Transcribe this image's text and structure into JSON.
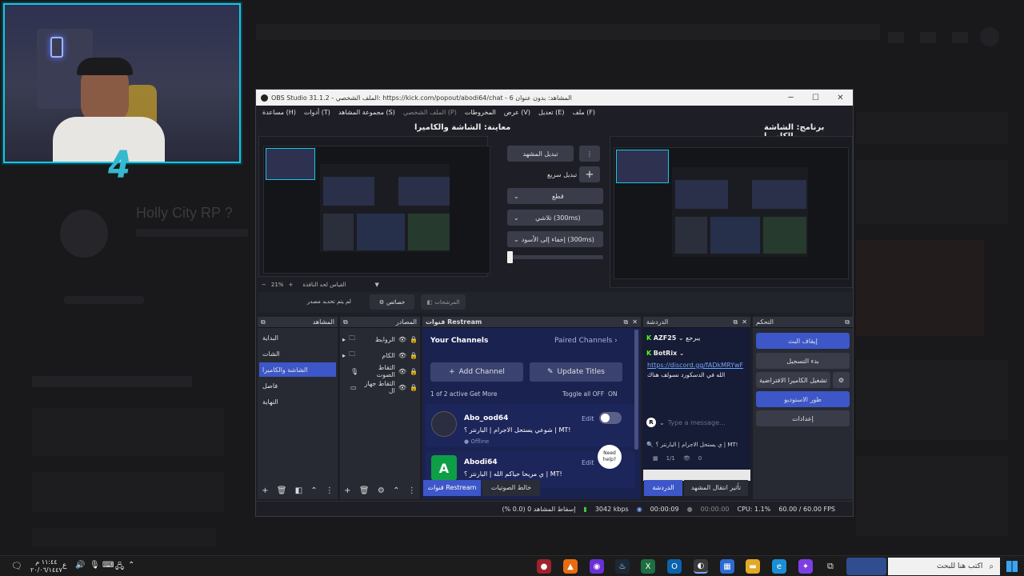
{
  "obs": {
    "title": "OBS Studio 31.1.2 - الملف الشخصي: https://kick.com/popout/abodi64/chat - المشاهد: بدون عنوان 6",
    "menu": [
      "ملف (F)",
      "تعديل (E)",
      "عرض (V)",
      "المخروطات",
      "الملف الشخصي (P)",
      "مجموعة المشاهد (S)",
      "أدوات (T)",
      "مساعدة (H)"
    ],
    "program_label": "برنامج: الشاشة والكاميرا",
    "preview_label": "معاينة: الشاشة والكاميرا",
    "transition": {
      "change_scene": "تبديل المشهد",
      "quick_transition": "تبديل سريع",
      "cut": "قطع",
      "fade": "تلاشي (300ms)",
      "fade_black": "إخفاء إلى الأسود (300ms)"
    },
    "zoom": "21%",
    "fit_label": "القياس لحد النافذة",
    "no_source": "لم يتم تحديد مصدر",
    "properties_btn": "خصائص",
    "filters_btn": "المرشحات",
    "scenes": {
      "title": "المشاهد",
      "items": [
        "البداية",
        "الشات",
        "الشاشة والكاميرا",
        "فاصل",
        "النهاية"
      ],
      "active_index": 2
    },
    "sources": {
      "title": "المصادر",
      "items": [
        "الروابط",
        "الكام",
        "التقاط الصوت",
        "التقاط جهاز ال"
      ]
    },
    "restream": {
      "title": "قنوات Restream",
      "your_channels": "Your Channels",
      "paired_channels": "Paired Channels",
      "add_channel": "Add Channel",
      "update_titles": "Update Titles",
      "active_info": "1 of 2 active",
      "get_more": "Get More",
      "toggle_all": "Toggle all OFF",
      "on": "ON",
      "channels": [
        {
          "name": "Abo_ood64",
          "title": "شوعي يستحل الاجرام | البارنتر ؟ | MT!",
          "status": "Offline",
          "edit": "Edit"
        },
        {
          "name": "Abodi64",
          "title": "ي مريحا حياكم الله | البارنتر ؟ | MT!",
          "edit": "Edit"
        }
      ],
      "need_help": "Need help?"
    },
    "chat": {
      "title": "الدردشة",
      "messages": [
        {
          "user": "AZF25",
          "text": "يبرجع"
        },
        {
          "user": "BotRix",
          "text": ""
        }
      ],
      "link": "https://discord.gg/fADkMRYwF",
      "line2": "الله في الدسكورد نسولف هناك",
      "placeholder": "Type a message...",
      "pinned": "ي يستحل الاجرام | البارنتر ؟ | MT!",
      "viewers": "1/1",
      "eye_count": "0"
    },
    "controls": {
      "title": "التحكم",
      "stop_stream": "إيقاف البث",
      "start_record": "بدء التسجيل",
      "virtual_cam": "تشغيل الكاميرا الافتراضية",
      "studio_mode": "طور الاستوديو",
      "settings": "إعدادات"
    },
    "bottom_tabs": {
      "restream": "قنوات Restream",
      "audio_mixer": "خالط الصوتيات",
      "chat": "الدردشة",
      "scene_transitions": "تأثير انتقال المشهد"
    },
    "status": {
      "dropped": "إسقاط المشاهد 0 (0.0 %)",
      "kbps": "3042 kbps",
      "live_time": "00:00:09",
      "rec_time": "00:00:00",
      "cpu": "CPU: 1.1%",
      "fps": "60.00 / 60.00 FPS"
    }
  },
  "background": {
    "heading": "Holly City RP ?"
  },
  "taskbar": {
    "search_placeholder": "اكتب هنا للبحث",
    "time": "١١:٤٤ م",
    "date": "٢٠/٠٦/١٤٤٧",
    "lang": "ع"
  }
}
